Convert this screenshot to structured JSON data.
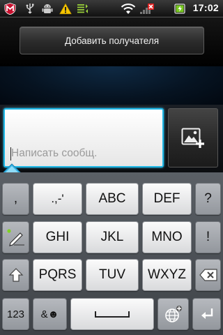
{
  "status_bar": {
    "time": "17:02",
    "icons": [
      "mcafee-icon",
      "usb-icon",
      "android-debug-icon",
      "warning-icon",
      "sync-icon",
      "wifi-icon",
      "signal-off-icon",
      "battery-icon"
    ]
  },
  "recipient": {
    "add_label": "Добавить получателя"
  },
  "compose": {
    "placeholder": "Написать сообщ.",
    "attach_icon": "add-picture-icon"
  },
  "keyboard": {
    "row1": [
      ",",
      ".,-'",
      "ABC",
      "DEF",
      "?"
    ],
    "row2": [
      "GHI",
      "JKL",
      "MNO",
      "!"
    ],
    "row3": [
      "PQRS",
      "TUV",
      "WXYZ"
    ],
    "row4": [
      "123",
      "&☻"
    ],
    "icons": [
      "handwriting-icon",
      "shift-icon",
      "backspace-icon",
      "space-icon",
      "language-settings-icon",
      "enter-icon"
    ],
    "accent_color": "#1db7e6"
  }
}
